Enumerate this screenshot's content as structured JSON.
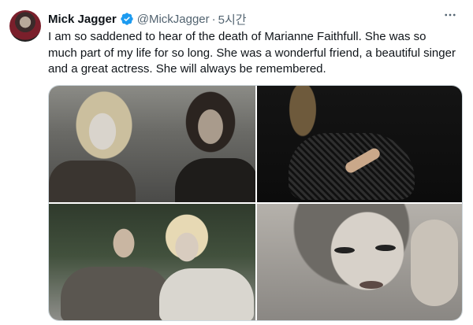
{
  "author": {
    "name": "Mick Jagger",
    "handle": "@MickJagger",
    "separator": "·",
    "time": "5시간"
  },
  "tweet": {
    "text": "I am so saddened to hear of the death of Marianne Faithfull. She was so much part of my life for so long. She was a wonderful friend, a beautiful singer and a great actress. She will always be remembered."
  },
  "icons": {
    "verified": "verified-badge-icon",
    "more": "more-options-icon"
  },
  "colors": {
    "verified": "#1d9bf0",
    "secondary_text": "#536471",
    "primary_text": "#0f1419"
  },
  "media": {
    "photo_count": 4
  }
}
